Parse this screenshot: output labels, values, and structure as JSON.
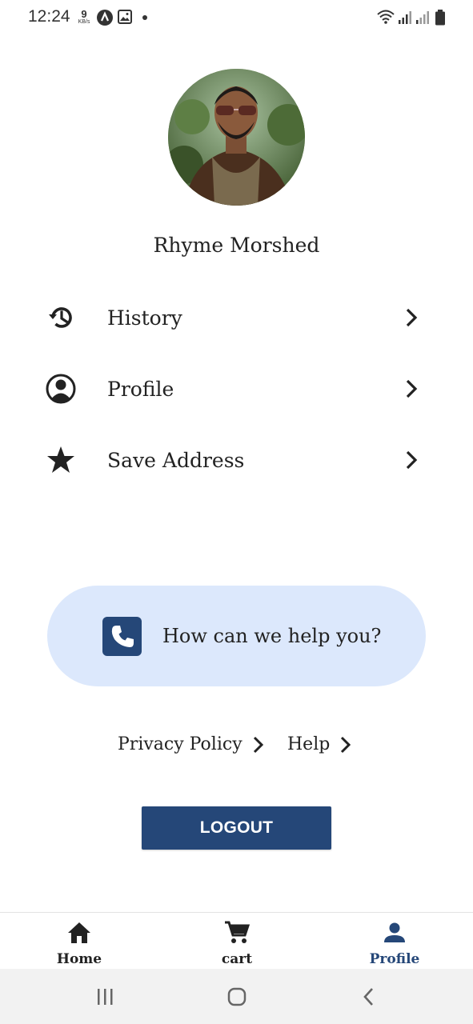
{
  "status_bar": {
    "time": "12:24",
    "speed_value": "9",
    "speed_unit": "KB/s",
    "icons": [
      "app-a-icon",
      "image-icon",
      "dot-icon",
      "wifi-icon",
      "signal-icon",
      "signal-weak-icon",
      "battery-icon"
    ]
  },
  "profile": {
    "name": "Rhyme Morshed"
  },
  "menu": {
    "items": [
      {
        "label": "History",
        "icon": "history-icon"
      },
      {
        "label": "Profile",
        "icon": "account-circle-icon"
      },
      {
        "label": "Save Address",
        "icon": "star-icon"
      }
    ]
  },
  "help": {
    "label": "How can we help you?",
    "icon": "phone-icon"
  },
  "links": {
    "privacy": "Privacy Policy",
    "help": "Help"
  },
  "logout_label": "LOGOUT",
  "bottom_nav": {
    "items": [
      {
        "label": "Home",
        "icon": "home-icon",
        "active": false
      },
      {
        "label": "cart",
        "icon": "cart-icon",
        "active": false
      },
      {
        "label": "Profile",
        "icon": "person-icon",
        "active": true
      }
    ]
  },
  "colors": {
    "accent": "#254778",
    "help_background": "#dce8fc",
    "text": "#222222"
  }
}
